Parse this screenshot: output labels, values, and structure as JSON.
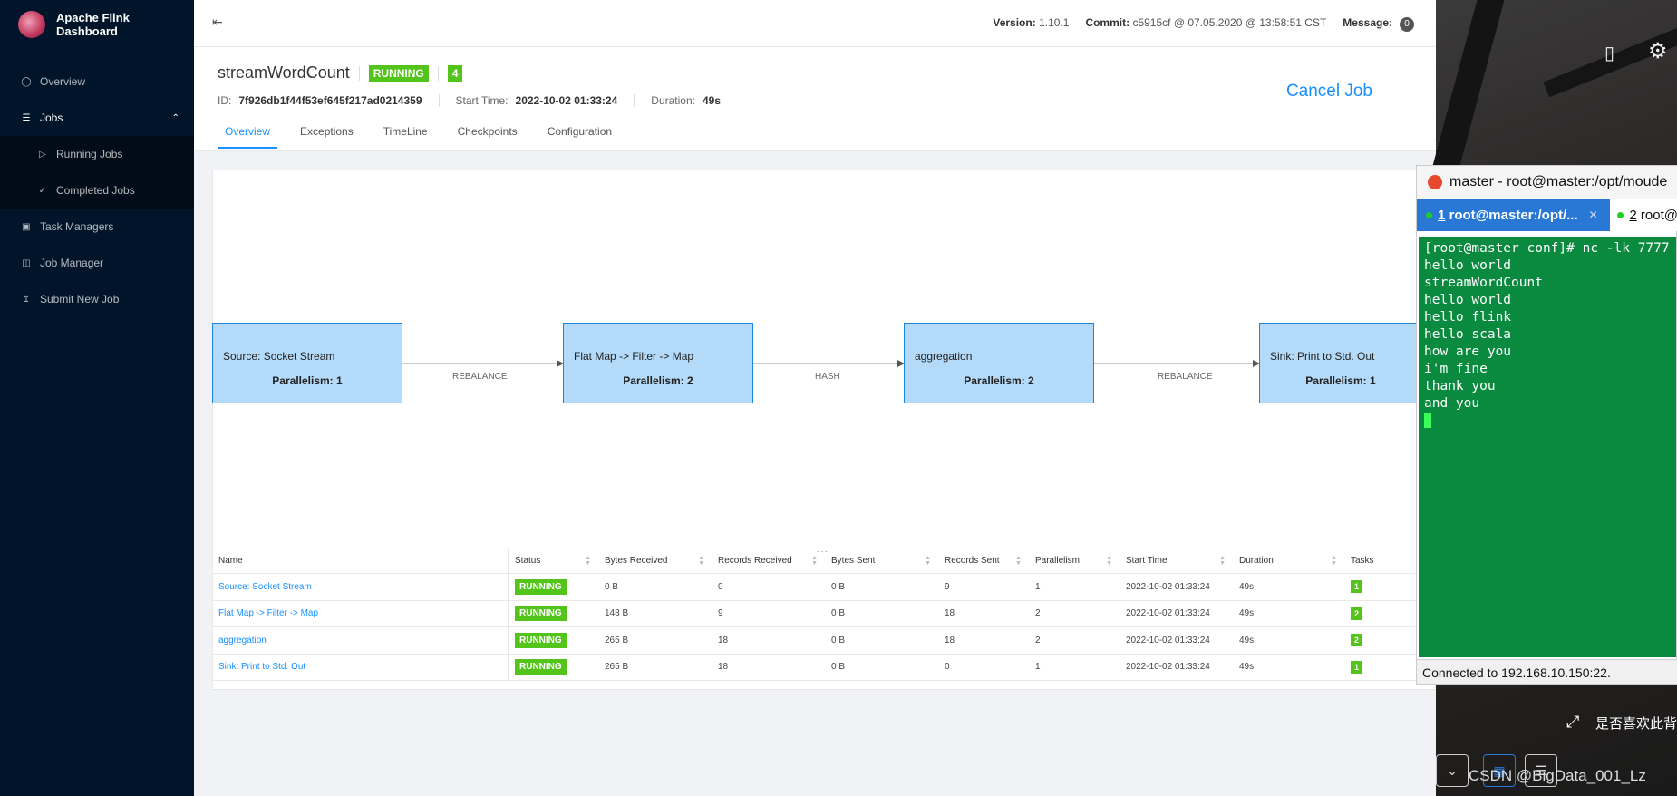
{
  "app": {
    "title": "Apache Flink Dashboard"
  },
  "sidebar": {
    "items": [
      {
        "label": "Overview",
        "icon": "dashboard-icon"
      },
      {
        "label": "Jobs",
        "icon": "list-icon"
      },
      {
        "label": "Running Jobs",
        "icon": "play-circle-icon"
      },
      {
        "label": "Completed Jobs",
        "icon": "check-circle-icon"
      },
      {
        "label": "Task Managers",
        "icon": "schedule-icon"
      },
      {
        "label": "Job Manager",
        "icon": "cluster-icon"
      },
      {
        "label": "Submit New Job",
        "icon": "upload-icon"
      }
    ]
  },
  "header": {
    "version_label": "Version:",
    "version": "1.10.1",
    "commit_label": "Commit:",
    "commit": "c5915cf @ 07.05.2020 @ 13:58:51 CST",
    "message_label": "Message:",
    "message_count": "0"
  },
  "job": {
    "name": "streamWordCount",
    "status": "RUNNING",
    "tasks": "4",
    "id_label": "ID:",
    "id": "7f926db1f44f53ef645f217ad0214359",
    "start_label": "Start Time:",
    "start": "2022-10-02 01:33:24",
    "duration_label": "Duration:",
    "duration": "49s",
    "cancel": "Cancel Job",
    "tabs": [
      "Overview",
      "Exceptions",
      "TimeLine",
      "Checkpoints",
      "Configuration"
    ],
    "drag_handle": "···"
  },
  "graph": {
    "nodes": [
      {
        "name": "Source: Socket Stream",
        "parallelism": "Parallelism: 1"
      },
      {
        "name": "Flat Map -> Filter -> Map",
        "parallelism": "Parallelism: 2"
      },
      {
        "name": "aggregation",
        "parallelism": "Parallelism: 2"
      },
      {
        "name": "Sink: Print to Std. Out",
        "parallelism": "Parallelism: 1"
      }
    ],
    "edges": [
      "REBALANCE",
      "HASH",
      "REBALANCE"
    ]
  },
  "table": {
    "headers": [
      "Name",
      "Status",
      "Bytes Received",
      "Records Received",
      "Bytes Sent",
      "Records Sent",
      "Parallelism",
      "Start Time",
      "Duration",
      "Tasks"
    ],
    "rows": [
      {
        "name": "Source: Socket Stream",
        "status": "RUNNING",
        "br": "0 B",
        "rr": "0",
        "bs": "0 B",
        "rs": "9",
        "par": "1",
        "st": "2022-10-02 01:33:24",
        "dur": "49s",
        "tasks": "1"
      },
      {
        "name": "Flat Map -> Filter -> Map",
        "status": "RUNNING",
        "br": "148 B",
        "rr": "9",
        "bs": "0 B",
        "rs": "18",
        "par": "2",
        "st": "2022-10-02 01:33:24",
        "dur": "49s",
        "tasks": "2"
      },
      {
        "name": "aggregation",
        "status": "RUNNING",
        "br": "265 B",
        "rr": "18",
        "bs": "0 B",
        "rs": "18",
        "par": "2",
        "st": "2022-10-02 01:33:24",
        "dur": "49s",
        "tasks": "2"
      },
      {
        "name": "Sink: Print to Std. Out",
        "status": "RUNNING",
        "br": "265 B",
        "rr": "18",
        "bs": "0 B",
        "rs": "0",
        "par": "1",
        "st": "2022-10-02 01:33:24",
        "dur": "49s",
        "tasks": "1"
      }
    ]
  },
  "terminal": {
    "title": "master - root@master:/opt/moude",
    "tab1_num": "1",
    "tab1": "root@master:/opt/...",
    "tab2_num": "2",
    "tab2": "root@",
    "lines": [
      "[root@master conf]# nc -lk 7777",
      "hello world",
      "streamWordCount",
      "hello world",
      "hello flink",
      "hello scala",
      "how are you",
      "i'm fine",
      "thank you",
      "and you"
    ],
    "status": "Connected to 192.168.10.150:22."
  },
  "overlay": {
    "cn_text": "是否喜欢此背",
    "watermark": "CSDN @BigData_001_Lz"
  },
  "colors": {
    "sidebar": "#001529",
    "accent": "#1890ff",
    "running": "#52c41a",
    "node_fill": "#b3daf8",
    "terminal_bg": "#0a8a3e"
  }
}
